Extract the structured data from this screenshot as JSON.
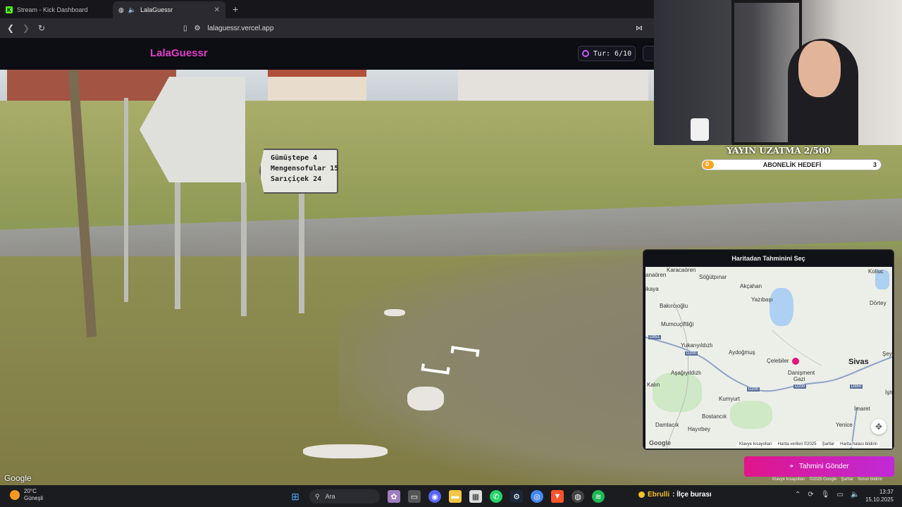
{
  "browser": {
    "tabs": [
      {
        "title": "Stream - Kick Dashboard"
      },
      {
        "title": "LalaGuessr"
      }
    ],
    "new_tab": "+",
    "url": "lalaguessr.vercel.app"
  },
  "site": {
    "logo": "LalaGuessr",
    "round": "Tur: 6/10"
  },
  "scene": {
    "sign_lines": [
      "Gümüştepe 4",
      "Mengensofular 15",
      "Sarıçiçek 24"
    ],
    "watermark": "Google"
  },
  "stream_overlay": {
    "title": "YAYIN UZATMA 2/500",
    "goal_label": "ABONELİK HEDEFİ",
    "goal_current": "0",
    "goal_target": "3",
    "goal_progress": 0
  },
  "map_panel": {
    "header": "Haritadan Tahminini Seç",
    "places": {
      "karacaoren": "Karacaören",
      "sogutpinar": "Söğütpınar",
      "kollu": "Kolluc",
      "anaoren": "anaören",
      "akcahan": "Akçahan",
      "ikaya": "ikaya",
      "yazibasi": "Yazıbaşı",
      "dortey": "Dörtey",
      "bakirciolu": "Bakırcıoğlu",
      "mumcuciftligi": "Mumcuçiftliği",
      "yukaniyildizli": "Yukarıyıldızlı",
      "aydogmus": "Aydoğmuş",
      "celebiler": "Çelebiler",
      "sivas": "Sivas",
      "seyh": "Şeyh",
      "danisment": "Danişment",
      "gazi": "Gazi",
      "asagiyildizli": "Aşağıyıldızlı",
      "kalin": "Kalın",
      "kumyurt": "Kumyurt",
      "ish": "İşh",
      "imaret": "İmaret",
      "bostancik": "Bostancık",
      "damlacik": "Damlacık",
      "hayirbey": "Hayırbey",
      "yenice": "Yenice"
    },
    "roads": {
      "d851": "D851",
      "d200a": "D200",
      "d200b": "D200",
      "d200c": "D200",
      "d850": "D850"
    },
    "google_logo": "Google",
    "footer": [
      "Klavye kısayolları",
      "Harita verileri ©2025",
      "Şartlar",
      "Harita hatası bildirin"
    ],
    "submit_label": "Tahmini Gönder",
    "bottom_links": [
      "Klavye kısayolları",
      "©2025 Google",
      "Şartlar",
      "Sorun bildirin"
    ]
  },
  "taskbar": {
    "temp": "20°C",
    "weather": "Güneşli",
    "search": "Ara",
    "chat_user": "Ebrulli",
    "chat_text": ": İlçe burası",
    "time": "13:37",
    "date": "15.10.2025"
  }
}
